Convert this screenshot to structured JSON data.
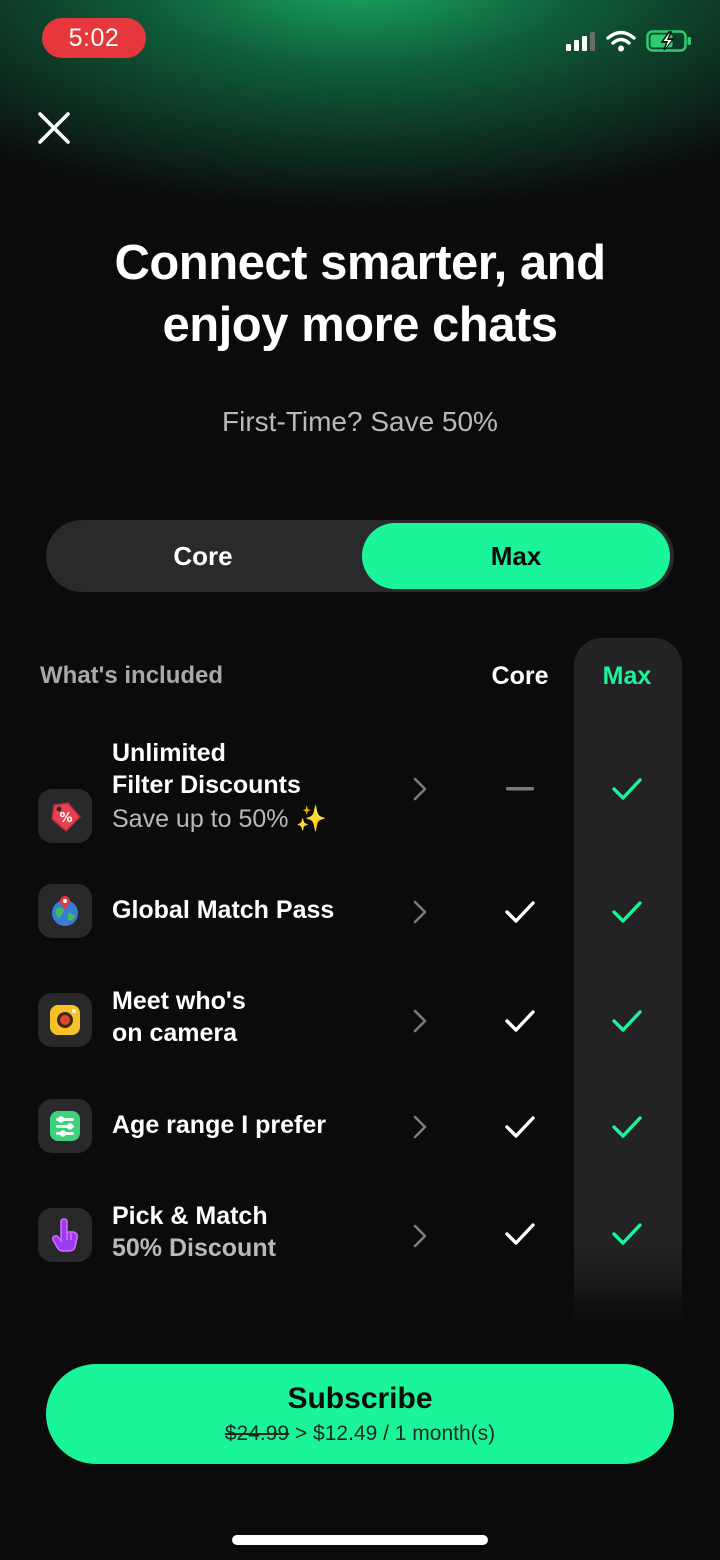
{
  "status_bar": {
    "time": "5:02"
  },
  "header": {
    "headline_line1": "Connect smarter, and",
    "headline_line2": "enjoy more chats",
    "subheadline": "First-Time? Save 50%"
  },
  "plan_toggle": {
    "core_label": "Core",
    "max_label": "Max",
    "selected": "Max"
  },
  "table": {
    "section_label": "What's included",
    "core_header": "Core",
    "max_header": "Max",
    "rows": [
      {
        "title_line1": "Unlimited",
        "title_line2": "Filter Discounts",
        "subtitle": "Save up to 50% ✨",
        "core": "dash",
        "max": "check",
        "icon": "discount-tag-icon"
      },
      {
        "title_line1": "Global Match Pass",
        "core": "check",
        "max": "check",
        "icon": "globe-pin-icon"
      },
      {
        "title_line1": "Meet who's",
        "title_line2": "on camera",
        "core": "check",
        "max": "check",
        "icon": "camera-icon"
      },
      {
        "title_line1": "Age range I prefer",
        "core": "check",
        "max": "check",
        "icon": "sliders-icon"
      },
      {
        "title_line1": "Pick & Match",
        "title_line2": "50% Discount",
        "core": "check",
        "max": "check",
        "icon": "pointing-hand-icon"
      }
    ]
  },
  "subscribe": {
    "label": "Subscribe",
    "old_price": "$24.99",
    "separator": " > ",
    "new_price": "$12.49 / 1 month(s)"
  },
  "colors": {
    "accent": "#19f598",
    "background": "#0b0b0c",
    "status_pill": "#e5373c"
  }
}
